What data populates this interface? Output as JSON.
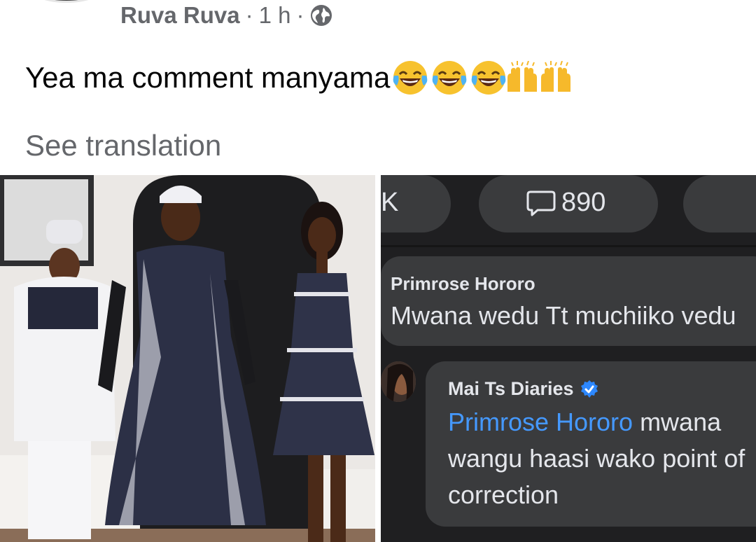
{
  "post": {
    "author": "Ruva Ruva",
    "separator1": "·",
    "time": "1 h",
    "separator2": "·",
    "privacy_icon": "globe-icon",
    "text": "Yea ma comment manyama",
    "emojis": [
      "face-with-tears-of-joy",
      "face-with-tears-of-joy",
      "face-with-tears-of-joy",
      "raising-hands",
      "raising-hands"
    ],
    "see_translation": "See translation"
  },
  "screenshot": {
    "tab_partial": "K",
    "comment_count": "890",
    "comment_icon": "comment-bubble-icon",
    "comment1": {
      "author": "Primrose Hororo",
      "text": "Mwana wedu Tt muchiiko vedu"
    },
    "reply": {
      "author": "Mai Ts Diaries",
      "verified_icon": "verified-badge-icon",
      "tag": "Primrose Hororo",
      "line1_rest": " mwana",
      "line2": "wangu haasi wako point of",
      "line3": "correction"
    }
  },
  "colors": {
    "secondary_text": "#65676b",
    "primary_text": "#050505",
    "dark_bg": "#1f1f21",
    "dark_bubble": "#3a3b3d",
    "mention_blue": "#4599ff"
  }
}
